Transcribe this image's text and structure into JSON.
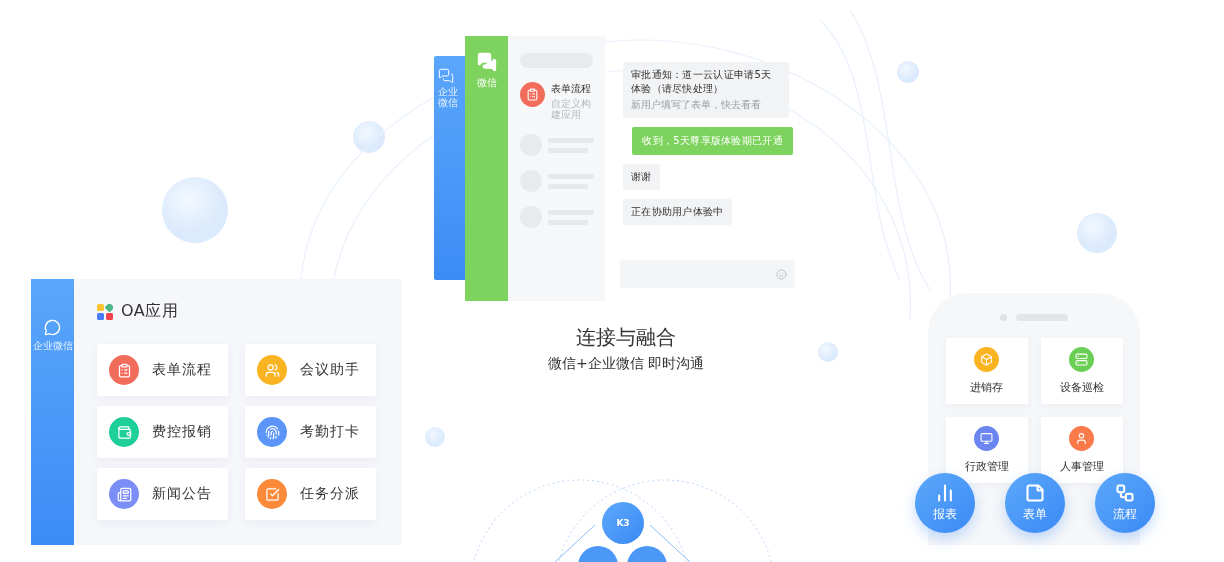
{
  "im_mockup": {
    "back_sidebar": {
      "label": "企业微信"
    },
    "sidebar": {
      "label": "微信"
    },
    "chat_list": [
      {
        "title": "表单流程",
        "subtitle": "自定义构建应用",
        "color": "#f26c5c"
      }
    ],
    "messages": [
      {
        "kind": "incoming",
        "text": "审批通知：道一云认证申请5天体验（请尽快处理）",
        "note": "新用户填写了表单，快去看看"
      },
      {
        "kind": "outgoing",
        "text": "收到，5天尊享版体验期已开通"
      },
      {
        "kind": "incoming",
        "text": "谢谢"
      },
      {
        "kind": "incoming",
        "text": "正在协助用户体验中"
      }
    ]
  },
  "headline": {
    "title": "连接与融合",
    "subtitle": "微信+企业微信 即时沟通"
  },
  "oa_panel": {
    "sidebar_label": "企业微信",
    "title": "OA应用",
    "apps": [
      {
        "label": "表单流程",
        "color": "#f26c5c"
      },
      {
        "label": "会议助手",
        "color": "#fbb421"
      },
      {
        "label": "费控报销",
        "color": "#1fcf9a"
      },
      {
        "label": "考勤打卡",
        "color": "#5b95f7"
      },
      {
        "label": "新闻公告",
        "color": "#7b8ef5"
      },
      {
        "label": "任务分派",
        "color": "#fb8a3a"
      }
    ]
  },
  "phone": {
    "apps": [
      {
        "label": "进销存",
        "color": "#fbb421"
      },
      {
        "label": "设备巡检",
        "color": "#6bcf55"
      },
      {
        "label": "行政管理",
        "color": "#6b86f0"
      },
      {
        "label": "人事管理",
        "color": "#fa7a4a"
      }
    ],
    "actions": [
      {
        "label": "报表"
      },
      {
        "label": "表单"
      },
      {
        "label": "流程"
      }
    ]
  },
  "orbit": {
    "nodes": [
      {
        "label": "K3"
      }
    ]
  }
}
